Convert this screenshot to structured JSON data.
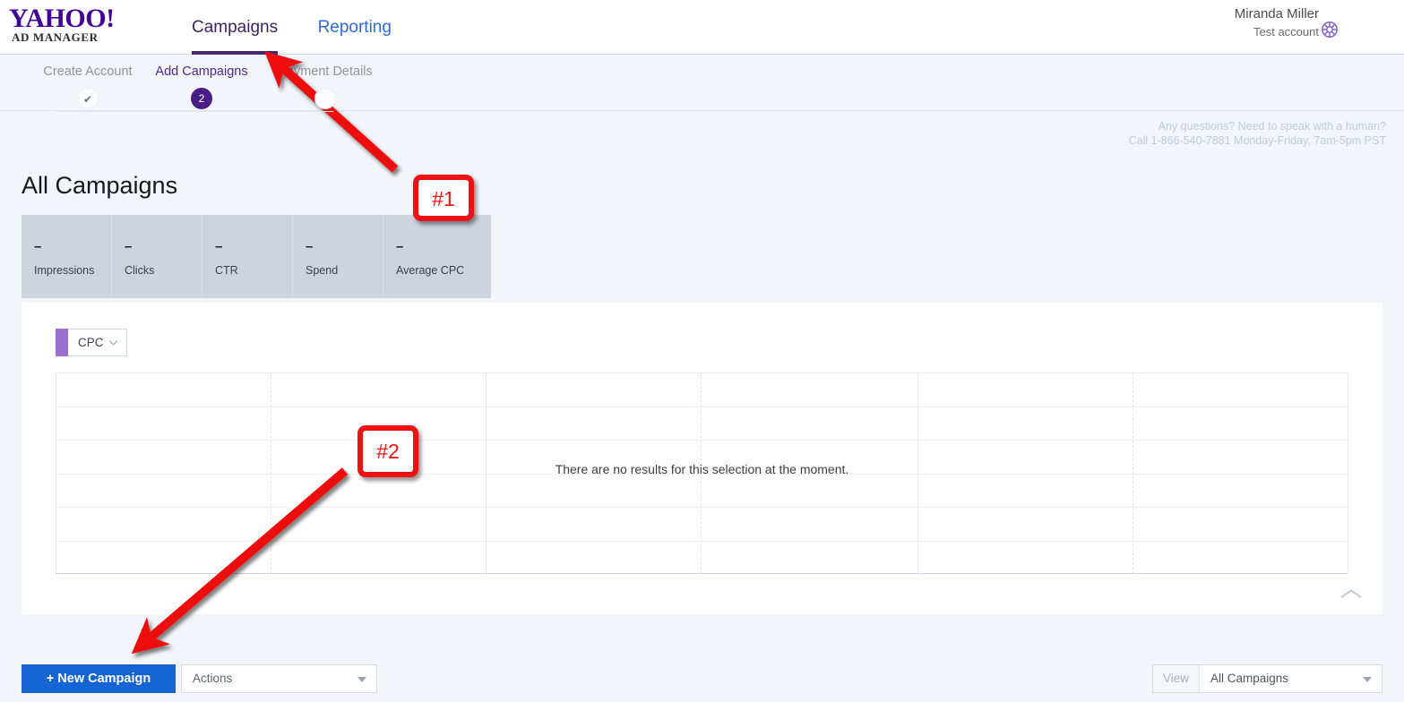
{
  "brand": {
    "logo_text": "YAHOO!",
    "logo_subtext": "AD MANAGER",
    "logo_color": "#430297",
    "accent_purple": "#4a1d86",
    "accent_blue": "#1663d4"
  },
  "header": {
    "tabs": [
      {
        "label": "Campaigns",
        "active": true
      },
      {
        "label": "Reporting",
        "active": false
      }
    ],
    "user_name": "Miranda Miller",
    "account_label": "Test account",
    "gear_icon": "gear-icon"
  },
  "subnav": {
    "steps": [
      {
        "label": "Create Account",
        "state": "done",
        "badge": "✔"
      },
      {
        "label": "Add Campaigns",
        "state": "current",
        "badge": "2"
      },
      {
        "label": "Payment Details",
        "state": "todo",
        "badge": ""
      }
    ],
    "help_line1": "Any questions? Need to speak with a human?",
    "help_line2": "Call 1-866-540-7881 Monday-Friday, 7am-5pm PST"
  },
  "main": {
    "page_title": "All Campaigns",
    "metrics": [
      {
        "value": "–",
        "name": "Impressions"
      },
      {
        "value": "–",
        "name": "Clicks"
      },
      {
        "value": "–",
        "name": "CTR"
      },
      {
        "value": "–",
        "name": "Spend"
      },
      {
        "value": "–",
        "name": "Average CPC"
      }
    ],
    "metric_select": {
      "selected": "CPC",
      "chevron_icon": "chevron-down-icon",
      "accent_color": "#9b6fcf"
    },
    "empty_state_message": "There are no results for this selection at the moment.",
    "collapse_icon": "chevron-up-icon"
  },
  "chart_data": {
    "type": "line",
    "title": "CPC",
    "xlabel": "",
    "ylabel": "CPC",
    "grid": true,
    "legend_position": "none",
    "series": [
      {
        "name": "CPC",
        "values": []
      }
    ],
    "categories": [],
    "x": [],
    "gridlines_horizontal": 7,
    "gridlines_vertical": 4,
    "empty": true,
    "empty_message": "There are no results for this selection at the moment."
  },
  "footer": {
    "new_campaign_label": "+ New Campaign",
    "actions_label": "Actions",
    "view_label": "View",
    "view_selected": "All Campaigns",
    "caret_icon": "caret-down-icon"
  },
  "annotations": [
    {
      "id": "1",
      "label": "#1",
      "color": "#ee1111"
    },
    {
      "id": "2",
      "label": "#2",
      "color": "#ee1111"
    }
  ]
}
